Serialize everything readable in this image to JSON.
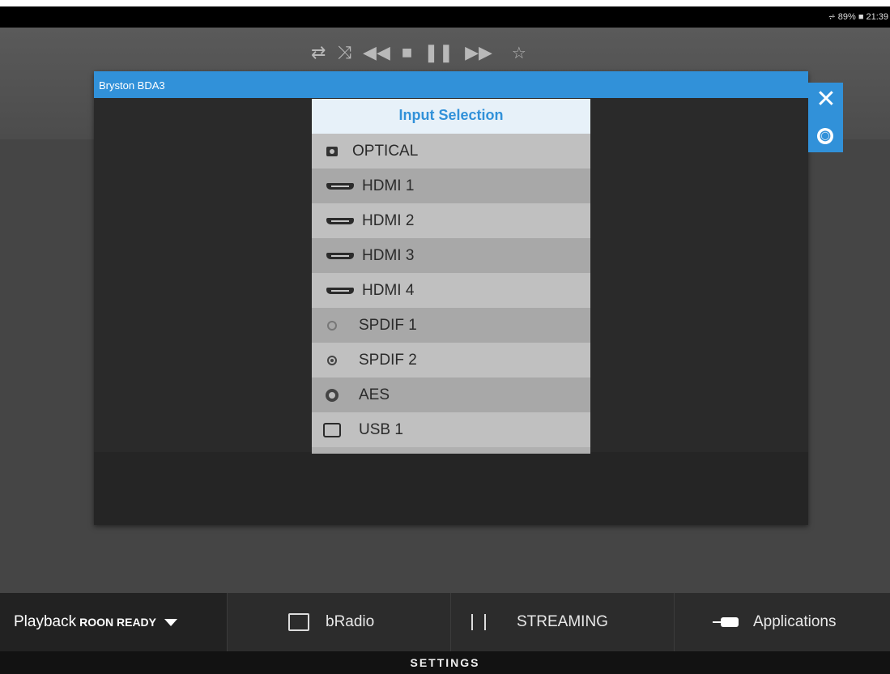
{
  "status": {
    "signal": "⩫",
    "battery": "89%",
    "time": "21:39"
  },
  "transport": {
    "icons": [
      "repeat-icon",
      "shuffle-icon",
      "rewind-icon",
      "stop-icon",
      "pause-icon",
      "forward-icon",
      "favorite-star-icon"
    ]
  },
  "dialog": {
    "title": "Bryston BDA3",
    "close_glyph": "✕",
    "globe_glyph": "◉"
  },
  "input_selection": {
    "header": "Input Selection",
    "items": [
      {
        "label": "OPTICAL",
        "icon": "optical-icon"
      },
      {
        "label": "HDMI 1",
        "icon": "hdmi-icon"
      },
      {
        "label": "HDMI 2",
        "icon": "hdmi-icon"
      },
      {
        "label": "HDMI 3",
        "icon": "hdmi-icon"
      },
      {
        "label": "HDMI 4",
        "icon": "hdmi-icon"
      },
      {
        "label": "SPDIF 1",
        "icon": "spdif-icon"
      },
      {
        "label": "SPDIF 2",
        "icon": "spdif-icon"
      },
      {
        "label": "AES",
        "icon": "aes-icon"
      },
      {
        "label": "USB 1",
        "icon": "usb-icon"
      }
    ]
  },
  "bottom_nav": {
    "playback_label": "Playback",
    "roon_label": "ROON READY",
    "bradio_label": "bRadio",
    "streaming_label": "STREAMING",
    "applications_label": "Applications"
  },
  "settings_label": "SETTINGS",
  "colors": {
    "accent": "#3191d9",
    "panel_header_bg": "#e7f1f9"
  }
}
